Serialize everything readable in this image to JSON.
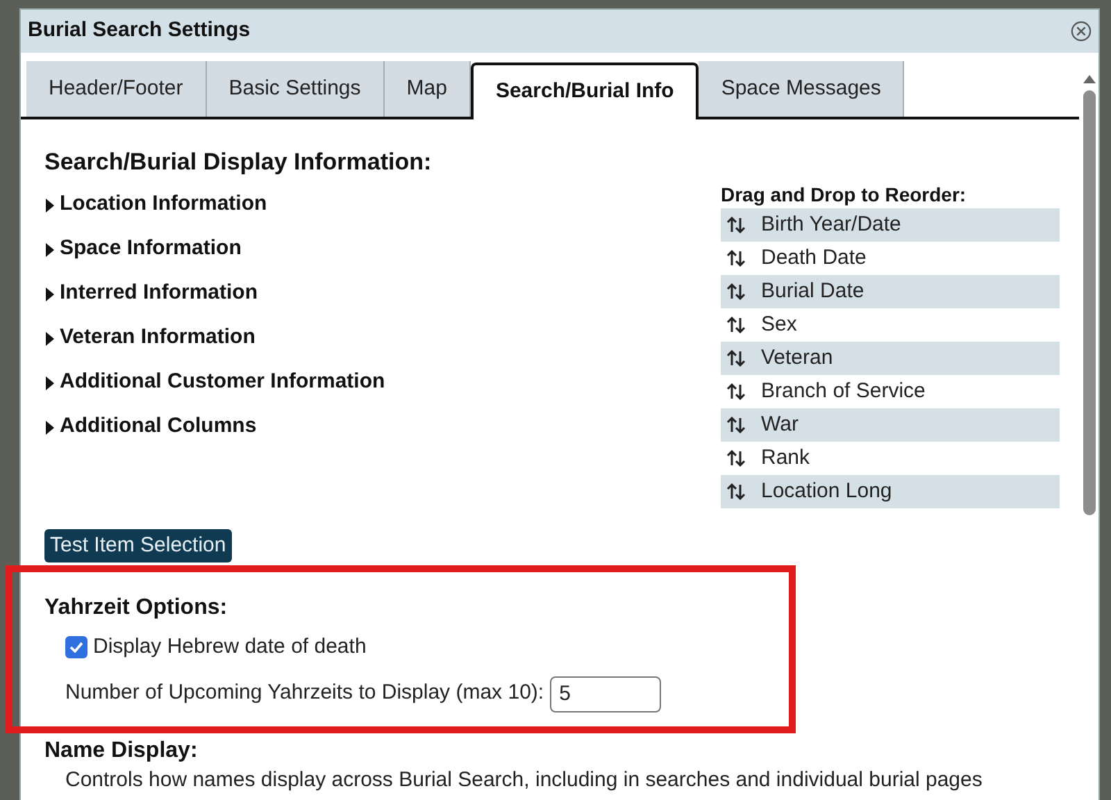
{
  "window": {
    "title": "Burial Search Settings"
  },
  "tabs": [
    {
      "label": "Header/Footer",
      "selected": false
    },
    {
      "label": "Basic Settings",
      "selected": false
    },
    {
      "label": "Map",
      "selected": false
    },
    {
      "label": "Search/Burial Info",
      "selected": true
    },
    {
      "label": "Space Messages",
      "selected": false
    }
  ],
  "display_info": {
    "heading": "Search/Burial Display Information:",
    "sections": [
      {
        "label": "Location Information",
        "expanded": false
      },
      {
        "label": "Space Information",
        "expanded": false
      },
      {
        "label": "Interred Information",
        "expanded": false
      },
      {
        "label": "Veteran Information",
        "expanded": false
      },
      {
        "label": "Additional Customer Information",
        "expanded": false
      },
      {
        "label": "Additional Columns",
        "expanded": false
      }
    ]
  },
  "reorder": {
    "heading": "Drag and Drop to Reorder:",
    "items": [
      "Birth Year/Date",
      "Death Date",
      "Burial Date",
      "Sex",
      "Veteran",
      "Branch of Service",
      "War",
      "Rank",
      "Location Long"
    ]
  },
  "test_button": "Test Item Selection",
  "yahrzeit": {
    "heading": "Yahrzeit Options:",
    "hebrew_date": {
      "label": "Display Hebrew date of death",
      "checked": true
    },
    "upcoming": {
      "label": "Number of Upcoming Yahrzeits to Display (max 10):",
      "value": "5"
    }
  },
  "name_display": {
    "heading": "Name Display:",
    "description": "Controls how names display across Burial Search, including in searches and individual burial pages"
  }
}
